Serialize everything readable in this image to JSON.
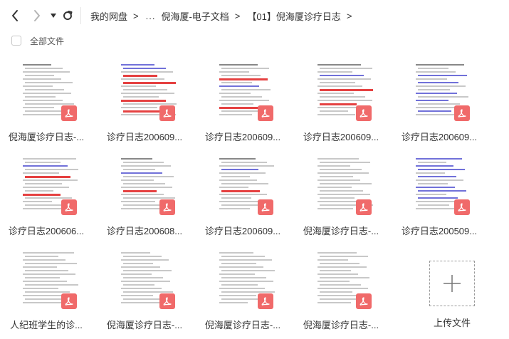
{
  "nav": {
    "back_icon": "chevron-left-icon",
    "forward_icon": "chevron-right-icon",
    "history_icon": "dropdown-caret-icon",
    "refresh_icon": "refresh-icon"
  },
  "breadcrumb": {
    "root": "我的网盘",
    "ellipsis": "...",
    "parent": "倪海厦-电子文档",
    "current": "【01】倪海厦诊疗日志",
    "separator": ">"
  },
  "select_all": {
    "label": "全部文件"
  },
  "colors": {
    "pdf_badge": "#f06a6a",
    "thumb_red": "#e02020",
    "thumb_blue": "#4e4ed0"
  },
  "files": [
    {
      "name": "倪海厦诊疗日志-...",
      "type": "pdf",
      "icon": "pdf-icon"
    },
    {
      "name": "诊疗日志200609...",
      "type": "pdf",
      "icon": "pdf-icon"
    },
    {
      "name": "诊疗日志200609...",
      "type": "pdf",
      "icon": "pdf-icon"
    },
    {
      "name": "诊疗日志200609...",
      "type": "pdf",
      "icon": "pdf-icon"
    },
    {
      "name": "诊疗日志200609...",
      "type": "pdf",
      "icon": "pdf-icon"
    },
    {
      "name": "诊疗日志200606...",
      "type": "pdf",
      "icon": "pdf-icon"
    },
    {
      "name": "诊疗日志200608...",
      "type": "pdf",
      "icon": "pdf-icon"
    },
    {
      "name": "诊疗日志200609...",
      "type": "pdf",
      "icon": "pdf-icon"
    },
    {
      "name": "倪海厦诊疗日志-...",
      "type": "pdf",
      "icon": "pdf-icon"
    },
    {
      "name": "诊疗日志200509...",
      "type": "pdf",
      "icon": "pdf-icon"
    },
    {
      "name": "人纪班学生的诊...",
      "type": "pdf",
      "icon": "pdf-icon"
    },
    {
      "name": "倪海厦诊疗日志-...",
      "type": "pdf",
      "icon": "pdf-icon"
    },
    {
      "name": "倪海厦诊疗日志-...",
      "type": "pdf",
      "icon": "pdf-icon"
    },
    {
      "name": "倪海厦诊疗日志-...",
      "type": "pdf",
      "icon": "pdf-icon"
    }
  ],
  "upload": {
    "label": "上传文件",
    "icon": "plus-icon"
  }
}
